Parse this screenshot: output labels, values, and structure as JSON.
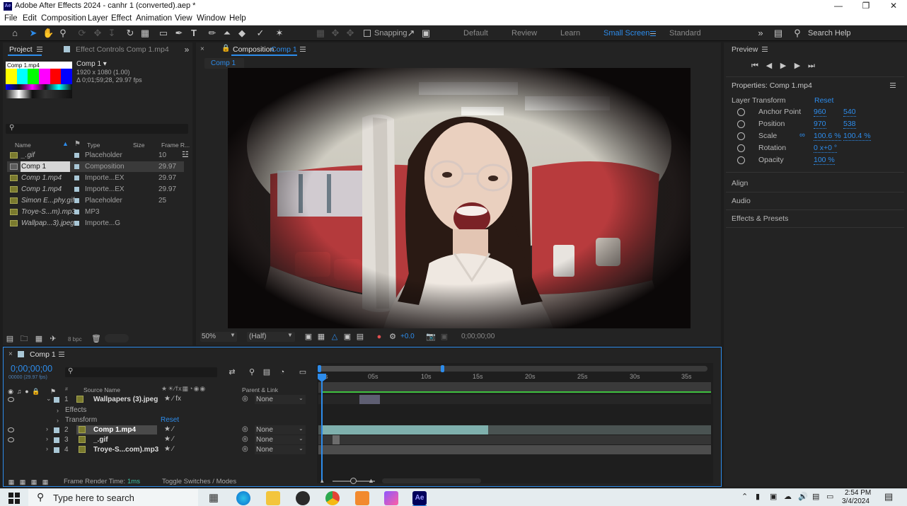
{
  "window": {
    "app_icon": "Ae",
    "title": "Adobe After Effects 2024 - canhr 1 (converted).aep *"
  },
  "menu": [
    "File",
    "Edit",
    "Composition",
    "Layer",
    "Effect",
    "Animation",
    "View",
    "Window",
    "Help"
  ],
  "toolbar": {
    "snapping_label": "Snapping",
    "workspaces": [
      "Default",
      "Review",
      "Learn",
      "Small Screen",
      "Standard"
    ],
    "active_workspace": "Small Screen",
    "search_help": "Search Help"
  },
  "project": {
    "tab_label": "Project",
    "effect_controls_tab": "Effect Controls Comp 1.mp4",
    "thumb_label": "Comp 1.mp4",
    "selected_name": "Comp 1 ▾",
    "selected_res": "1920 x 1080 (1.00)",
    "selected_dur": "Δ 0;01;59;28, 29.97 fps",
    "search_placeholder": "",
    "columns": {
      "name": "Name",
      "type": "Type",
      "size": "Size",
      "framerate": "Frame R..."
    },
    "items": [
      {
        "name": "_.gif",
        "type": "Placeholder",
        "fr": "10"
      },
      {
        "name": "Comp 1",
        "type": "Composition",
        "fr": "29.97"
      },
      {
        "name": "Comp 1.mp4",
        "type": "Importe...EX",
        "fr": "29.97"
      },
      {
        "name": "Comp 1.mp4",
        "type": "Importe...EX",
        "fr": "29.97"
      },
      {
        "name": "Simon E...phy.gif",
        "type": "Placeholder",
        "fr": "25"
      },
      {
        "name": "Troye-S...m).mp3",
        "type": "MP3",
        "fr": ""
      },
      {
        "name": "Wallpap...3).jpeg",
        "type": "Importe...G",
        "fr": ""
      }
    ],
    "bpc": "8 bpc"
  },
  "composition": {
    "tab_prefix": "Composition",
    "tab_name": "Comp 1",
    "breadcrumb": "Comp 1",
    "zoom": "50%",
    "resolution": "(Half)",
    "exposure": "+0.0",
    "timecode": "0;00;00;00"
  },
  "preview": {
    "title": "Preview"
  },
  "properties": {
    "title": "Properties: Comp 1.mp4",
    "group": "Layer Transform",
    "reset": "Reset",
    "rows": [
      {
        "label": "Anchor Point",
        "v1": "960",
        "v2": "540"
      },
      {
        "label": "Position",
        "v1": "970",
        "v2": "538"
      },
      {
        "label": "Scale",
        "v1": "100.6 %",
        "v2": "100.4 %"
      },
      {
        "label": "Rotation",
        "v1": "0 x+0 °",
        "v2": ""
      },
      {
        "label": "Opacity",
        "v1": "100 %",
        "v2": ""
      }
    ],
    "sections": [
      "Align",
      "Audio",
      "Effects & Presets"
    ]
  },
  "timeline": {
    "tab": "Comp 1",
    "timecode": "0;00;00;00",
    "timecode_sub": "00000 (29.97 fps)",
    "col_source": "Source Name",
    "col_parent": "Parent & Link",
    "ruler": [
      "0s",
      "05s",
      "10s",
      "15s",
      "20s",
      "25s",
      "30s",
      "35s"
    ],
    "layers": [
      {
        "num": "1",
        "name": "Wallpapers (3).jpeg",
        "parent": "None"
      },
      {
        "num": "2",
        "name": "Comp 1.mp4",
        "parent": "None"
      },
      {
        "num": "3",
        "name": "_.gif",
        "parent": "None"
      },
      {
        "num": "4",
        "name": "Troye-S...com).mp3",
        "parent": "None"
      }
    ],
    "sub_effects": "Effects",
    "sub_transform": "Transform",
    "sub_reset": "Reset",
    "frame_render_label": "Frame Render Time:",
    "frame_render_value": "1ms",
    "toggle_label": "Toggle Switches / Modes"
  },
  "taskbar": {
    "search_placeholder": "Type here to search",
    "time": "2:54 PM",
    "date": "3/4/2024"
  }
}
